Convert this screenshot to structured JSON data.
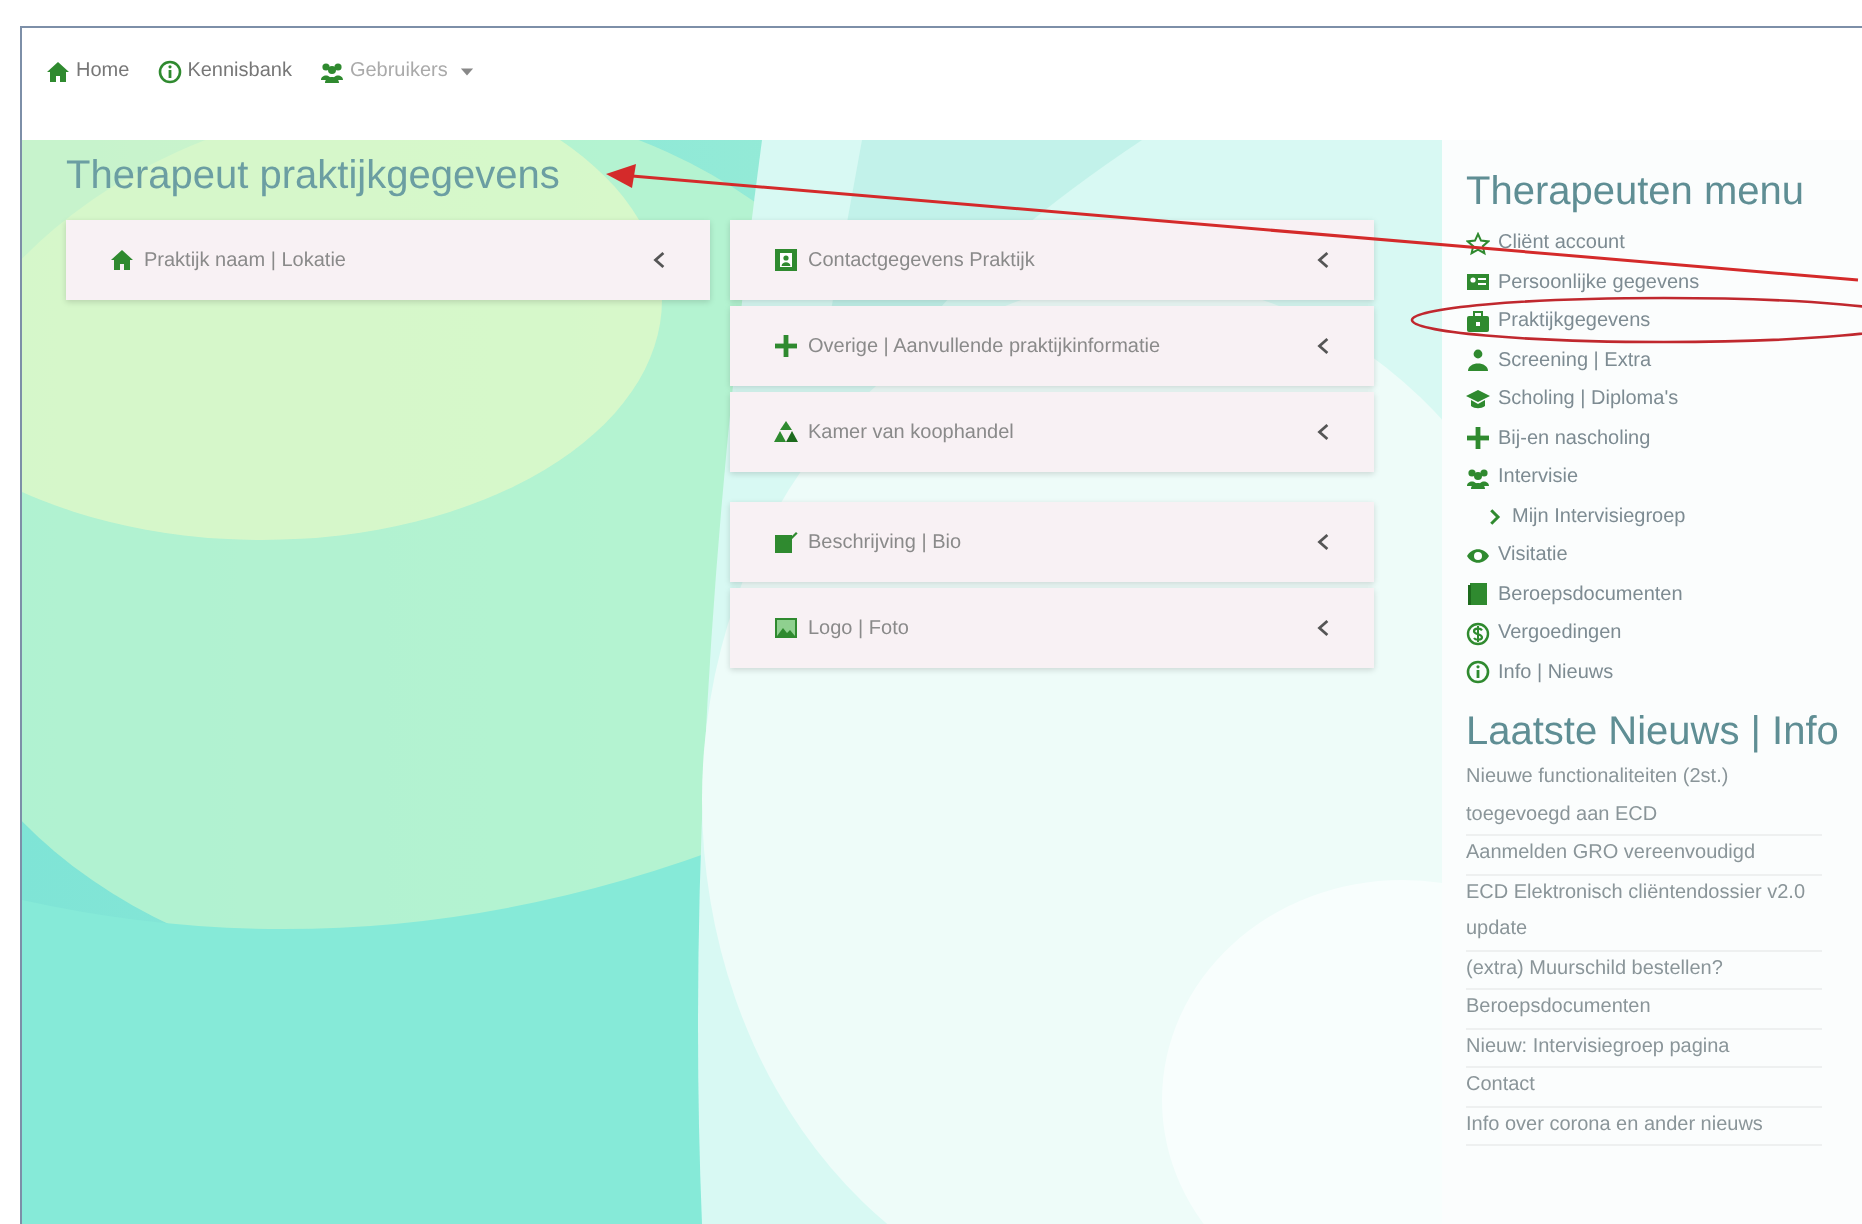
{
  "nav": [
    {
      "label": "Home",
      "dropdown": false
    },
    {
      "label": "Kennisbank",
      "dropdown": false
    },
    {
      "label": "Gebruikers",
      "dropdown": true
    }
  ],
  "page_title": "Therapeut praktijkgegevens",
  "columns": [
    {
      "groups": [
        {
          "items": [
            {
              "label": "Praktijk naam | Lokatie"
            }
          ]
        }
      ]
    },
    {
      "groups": [
        {
          "items": [
            {
              "label": "Contactgegevens Praktijk"
            },
            {
              "label": "Overige | Aanvullende praktijkinformatie"
            },
            {
              "label": "Kamer van koophandel"
            }
          ]
        },
        {
          "items": [
            {
              "label": "Beschrijving | Bio"
            },
            {
              "label": "Logo | Foto"
            }
          ]
        }
      ]
    }
  ],
  "sidebar": {
    "title": "Therapeuten menu",
    "items": [
      {
        "label": "Cliënt account"
      },
      {
        "label": "Persoonlijke gegevens"
      },
      {
        "label": "Praktijkgegevens"
      },
      {
        "label": "Screening | Extra"
      },
      {
        "label": "Scholing | Diploma's"
      },
      {
        "label": "Bij-en nascholing"
      },
      {
        "label": "Intervisie",
        "children": [
          {
            "label": "Mijn Intervisiegroep"
          }
        ]
      },
      {
        "label": "Visitatie"
      },
      {
        "label": "Beroepsdocumenten"
      },
      {
        "label": "Vergoedingen"
      },
      {
        "label": "Info | Nieuws"
      }
    ]
  },
  "news": {
    "title": "Laatste Nieuws | Info",
    "items": [
      "Nieuwe functionaliteiten (2st.) toegevoegd aan ECD",
      "Aanmelden GRO vereenvoudigd",
      "ECD Elektronisch cliëntendossier v2.0 update",
      "(extra) Muurschild bestellen?",
      "Beroepsdocumenten",
      "Nieuw: Intervisiegroep pagina",
      "Contact",
      "Info over corona en ander nieuws"
    ]
  },
  "annotations": [
    {
      "kind": "arrow",
      "color": "#d42a2a"
    },
    {
      "kind": "ellipse",
      "color": "#c0282e"
    }
  ]
}
